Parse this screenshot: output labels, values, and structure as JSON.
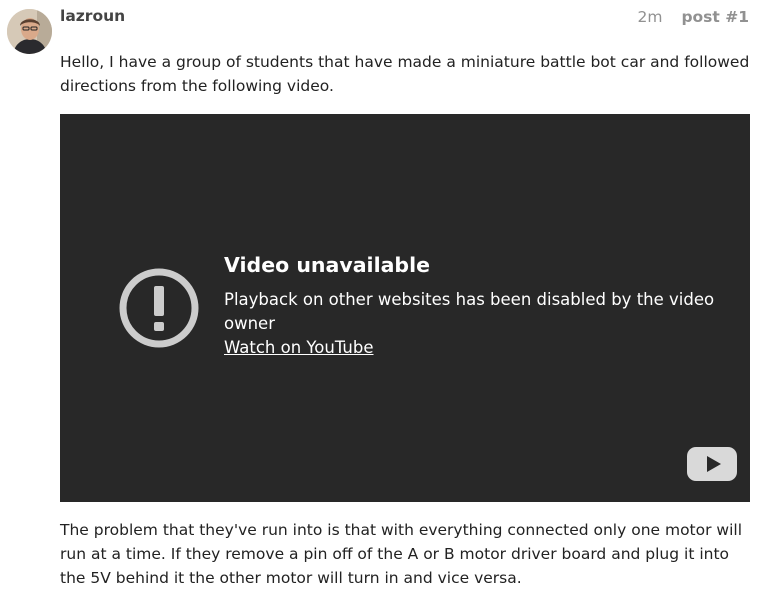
{
  "post": {
    "username": "lazroun",
    "age": "2m",
    "post_number": "post #1",
    "paragraph_1": "Hello, I have a group of students that have made a miniature battle bot car and followed directions from the following video.",
    "paragraph_2": "The problem that they've run into is that with everything connected only one motor will run at a time. If they remove a pin off of the A or B motor driver board and plug it into the 5V behind it the other motor will turn in and vice versa."
  },
  "video": {
    "title": "Video unavailable",
    "message": "Playback on other websites has been disabled by the video owner",
    "link_label": "Watch on YouTube",
    "icons": {
      "warning": "exclamation-circle-icon",
      "logo": "youtube-play-icon"
    },
    "colors": {
      "background": "#282828",
      "icon": "#cccccc",
      "text": "#ffffff"
    }
  }
}
